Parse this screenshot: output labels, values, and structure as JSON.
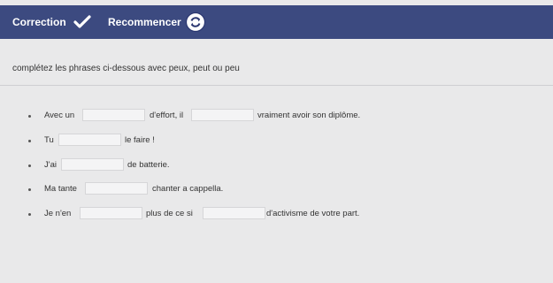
{
  "toolbar": {
    "correction_label": "Correction",
    "recommencer_label": "Recommencer",
    "correction_icon": "check-icon",
    "recommencer_icon": "reload-icon",
    "bar_color": "#3c4a80"
  },
  "instructions": "complétez les phrases ci-dessous avec peux, peut ou peu",
  "sentences": [
    {
      "parts": [
        "Avec un",
        "d'effort, il",
        "vraiment avoir son diplôme."
      ],
      "blanks": 2,
      "values": [
        "",
        ""
      ]
    },
    {
      "parts": [
        "Tu",
        "le faire !"
      ],
      "blanks": 1,
      "values": [
        ""
      ]
    },
    {
      "parts": [
        "J'ai",
        "de batterie."
      ],
      "blanks": 1,
      "values": [
        ""
      ]
    },
    {
      "parts": [
        "Ma tante",
        "chanter a cappella."
      ],
      "blanks": 1,
      "values": [
        ""
      ]
    },
    {
      "parts": [
        "Je n'en",
        "plus de ce si",
        "d'activisme de votre part."
      ],
      "blanks": 2,
      "values": [
        "",
        ""
      ]
    }
  ]
}
